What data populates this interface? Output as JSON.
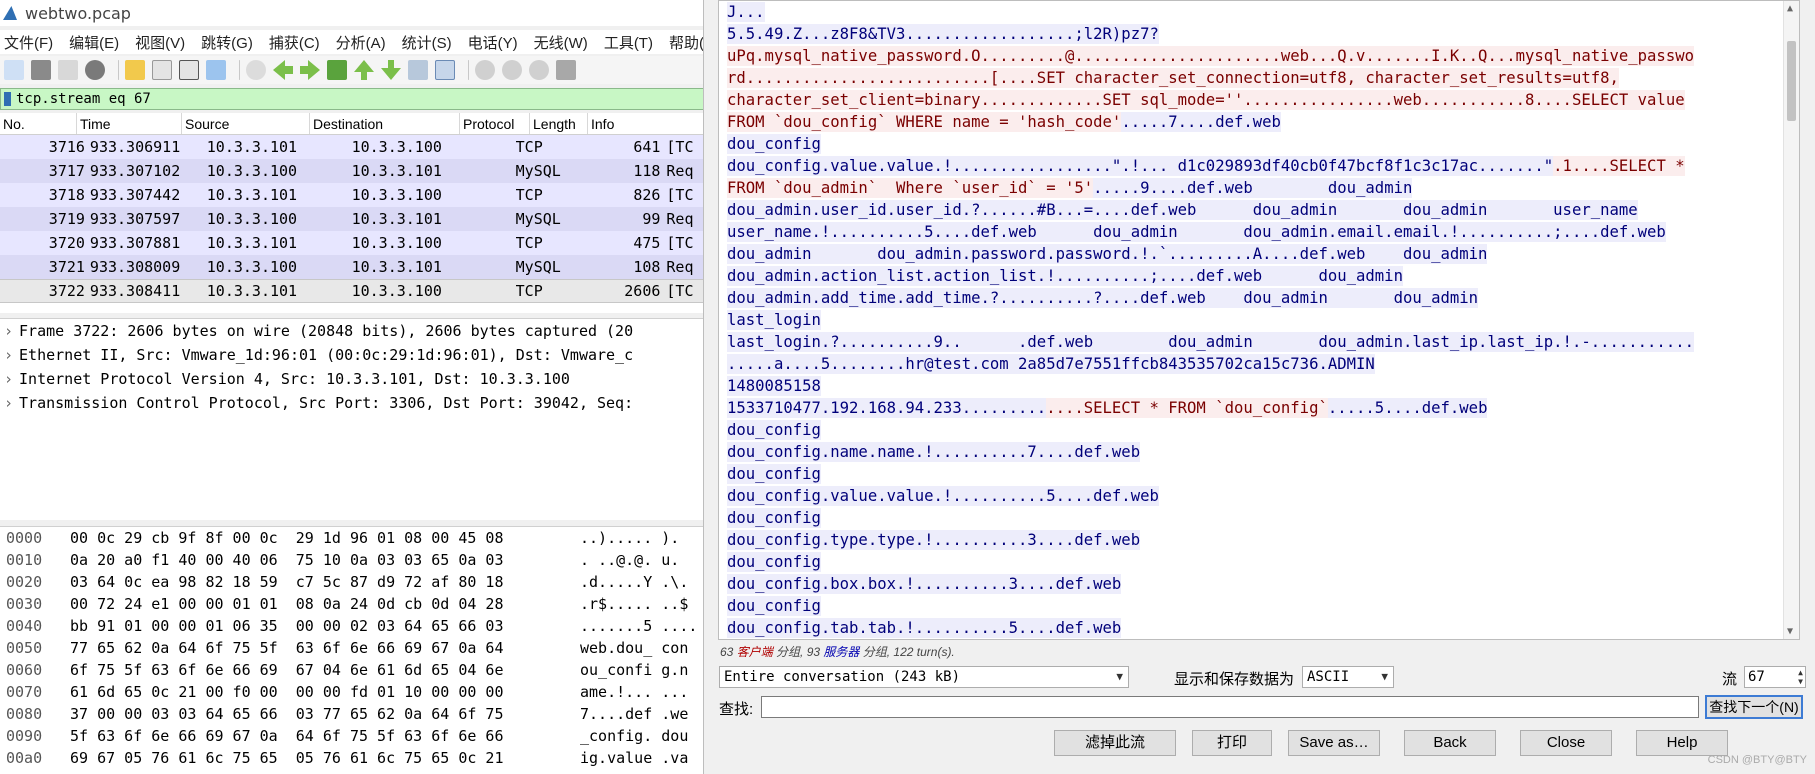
{
  "title": "webtwo.pcap",
  "menu": [
    "文件(F)",
    "编辑(E)",
    "视图(V)",
    "跳转(G)",
    "捕获(C)",
    "分析(A)",
    "统计(S)",
    "电话(Y)",
    "无线(W)",
    "工具(T)",
    "帮助("
  ],
  "display_filter": "tcp.stream eq 67",
  "packet_list": {
    "headers": [
      "No.",
      "Time",
      "Source",
      "Destination",
      "Protocol",
      "Length",
      "Info"
    ],
    "rows": [
      {
        "no": "3716",
        "time": "933.306911",
        "src": "10.3.3.101",
        "dst": "10.3.3.100",
        "proto": "TCP",
        "len": "641",
        "info": "[TC"
      },
      {
        "no": "3717",
        "time": "933.307102",
        "src": "10.3.3.100",
        "dst": "10.3.3.101",
        "proto": "MySQL",
        "len": "118",
        "info": "Req"
      },
      {
        "no": "3718",
        "time": "933.307442",
        "src": "10.3.3.101",
        "dst": "10.3.3.100",
        "proto": "TCP",
        "len": "826",
        "info": "[TC"
      },
      {
        "no": "3719",
        "time": "933.307597",
        "src": "10.3.3.100",
        "dst": "10.3.3.101",
        "proto": "MySQL",
        "len": "99",
        "info": "Req"
      },
      {
        "no": "3720",
        "time": "933.307881",
        "src": "10.3.3.101",
        "dst": "10.3.3.100",
        "proto": "TCP",
        "len": "475",
        "info": "[TC"
      },
      {
        "no": "3721",
        "time": "933.308009",
        "src": "10.3.3.100",
        "dst": "10.3.3.101",
        "proto": "MySQL",
        "len": "108",
        "info": "Req"
      },
      {
        "no": "3722",
        "time": "933.308411",
        "src": "10.3.3.101",
        "dst": "10.3.3.100",
        "proto": "TCP",
        "len": "2606",
        "info": "[TC"
      }
    ]
  },
  "details": [
    "Frame 3722: 2606 bytes on wire (20848 bits), 2606 bytes captured (20",
    "Ethernet II, Src: Vmware_1d:96:01 (00:0c:29:1d:96:01), Dst: Vmware_c",
    "Internet Protocol Version 4, Src: 10.3.3.101, Dst: 10.3.3.100",
    "Transmission Control Protocol, Src Port: 3306, Dst Port: 39042, Seq:"
  ],
  "hex": [
    {
      "off": "0000",
      "bytes": "00 0c 29 cb 9f 8f 00 0c  29 1d 96 01 08 00 45 08",
      "ascii": "..)..... )."
    },
    {
      "off": "0010",
      "bytes": "0a 20 a0 f1 40 00 40 06  75 10 0a 03 03 65 0a 03",
      "ascii": ". ..@.@. u."
    },
    {
      "off": "0020",
      "bytes": "03 64 0c ea 98 82 18 59  c7 5c 87 d9 72 af 80 18",
      "ascii": ".d.....Y .\\."
    },
    {
      "off": "0030",
      "bytes": "00 72 24 e1 00 00 01 01  08 0a 24 0d cb 0d 04 28",
      "ascii": ".r$..... ..$"
    },
    {
      "off": "0040",
      "bytes": "bb 91 01 00 00 01 06 35  00 00 02 03 64 65 66 03",
      "ascii": ".......5 ...."
    },
    {
      "off": "0050",
      "bytes": "77 65 62 0a 64 6f 75 5f  63 6f 6e 66 69 67 0a 64",
      "ascii": "web.dou_ con"
    },
    {
      "off": "0060",
      "bytes": "6f 75 5f 63 6f 6e 66 69  67 04 6e 61 6d 65 04 6e",
      "ascii": "ou_confi g.n"
    },
    {
      "off": "0070",
      "bytes": "61 6d 65 0c 21 00 f0 00  00 00 fd 01 10 00 00 00",
      "ascii": "ame.!... ..."
    },
    {
      "off": "0080",
      "bytes": "37 00 00 03 03 64 65 66  03 77 65 62 0a 64 6f 75",
      "ascii": "7....def .we"
    },
    {
      "off": "0090",
      "bytes": "5f 63 6f 6e 66 69 67 0a  64 6f 75 5f 63 6f 6e 66",
      "ascii": "_config. dou"
    },
    {
      "off": "00a0",
      "bytes": "69 67 05 76 61 6c 75 65  05 76 61 6c 75 65 0c 21",
      "ascii": "ig.value .va"
    }
  ],
  "stream": [
    [
      {
        "t": "J...",
        "k": "srv"
      }
    ],
    [
      {
        "t": "5.5.49.Z...z8F8&TV3..................;l2R)pz7?",
        "k": "srv"
      }
    ],
    [
      {
        "t": "uPq.mysql_native_password.O.........@......................web...Q.v.......I.K..Q...mysql_native_passwo",
        "k": "cli"
      }
    ],
    [
      {
        "t": "rd..........................[....SET character_set_connection=utf8, character_set_results=utf8,",
        "k": "cli"
      }
    ],
    [
      {
        "t": "character_set_client=binary.............SET sql_mode=''................web...........8....SELECT value",
        "k": "cli"
      }
    ],
    [
      {
        "t": "FROM `dou_config` WHERE name = 'hash_code'",
        "k": "cli"
      },
      {
        "t": ".....7....def.web",
        "k": "srv"
      }
    ],
    [
      {
        "t": "dou_config",
        "k": "srv"
      }
    ],
    [
      {
        "t": "dou_config.value.value.!.................\".!... d1c029893df40cb0f47bcf8f1c3c17ac.......\"",
        "k": "srv"
      },
      {
        "t": ".1....SELECT *",
        "k": "cli"
      }
    ],
    [
      {
        "t": "FROM `dou_admin`  Where `user_id` = '5'",
        "k": "cli"
      },
      {
        "t": ".....9....def.web        dou_admin",
        "k": "srv"
      }
    ],
    [
      {
        "t": "dou_admin.user_id.user_id.?......#B...=....def.web      dou_admin       dou_admin       user_name",
        "k": "srv"
      }
    ],
    [
      {
        "t": "user_name.!..........5....def.web      dou_admin       dou_admin.email.email.!..........;....def.web",
        "k": "srv"
      }
    ],
    [
      {
        "t": "dou_admin       dou_admin.password.password.!.`.........A....def.web    dou_admin",
        "k": "srv"
      }
    ],
    [
      {
        "t": "dou_admin.action_list.action_list.!..........;....def.web      dou_admin",
        "k": "srv"
      }
    ],
    [
      {
        "t": "dou_admin.add_time.add_time.?..........?....def.web    dou_admin       dou_admin",
        "k": "srv"
      }
    ],
    [
      {
        "t": "last_login",
        "k": "srv"
      }
    ],
    [
      {
        "t": "last_login.?..........9..      .def.web        dou_admin       dou_admin.last_ip.last_ip.!.-...........",
        "k": "srv"
      }
    ],
    [
      {
        "t": ".....a....5........hr@test.com 2a85d7e7551ffcb843535702ca15c736.ADMIN",
        "k": "srv"
      }
    ],
    [
      {
        "t": "1480085158",
        "k": "srv"
      }
    ],
    [
      {
        "t": "1533710477.192.168.94.233.........",
        "k": "srv"
      },
      {
        "t": "....SELECT * FROM `dou_config`",
        "k": "cli"
      },
      {
        "t": ".....5....def.web",
        "k": "srv"
      }
    ],
    [
      {
        "t": "dou_config",
        "k": "srv"
      }
    ],
    [
      {
        "t": "dou_config.name.name.!..........7....def.web",
        "k": "srv"
      }
    ],
    [
      {
        "t": "dou_config",
        "k": "srv"
      }
    ],
    [
      {
        "t": "dou_config.value.value.!..........5....def.web",
        "k": "srv"
      }
    ],
    [
      {
        "t": "dou_config",
        "k": "srv"
      }
    ],
    [
      {
        "t": "dou_config.type.type.!..........3....def.web",
        "k": "srv"
      }
    ],
    [
      {
        "t": "dou_config",
        "k": "srv"
      }
    ],
    [
      {
        "t": "dou_config.box.box.!..........3....def.web",
        "k": "srv"
      }
    ],
    [
      {
        "t": "dou_config",
        "k": "srv"
      }
    ],
    [
      {
        "t": "dou_config.tab.tab.!..........5....def.web",
        "k": "srv"
      }
    ]
  ],
  "summary": {
    "a": "63 ",
    "client": "客户端",
    "b": " 分组, 93 ",
    "server": "服务器",
    "c": " 分组, 122 turn(s)."
  },
  "conversation": "Entire conversation (243 kB)",
  "show_save_label": "显示和保存数据为",
  "encoding": "ASCII",
  "stream_label": "流",
  "stream_number": "67",
  "find_label": "查找:",
  "find_value": "",
  "find_next": "查找下一个(N)",
  "buttons": {
    "filter_out": "滤掉此流",
    "print": "打印",
    "save_as": "Save as…",
    "back": "Back",
    "close": "Close",
    "help": "Help"
  },
  "watermark": "CSDN @BTY@BTY",
  "colors": {
    "client_bg": "#fbeded",
    "client_fg": "#7a0000",
    "server_bg": "#ededfb",
    "server_fg": "#00007a",
    "filter_ok": "#c8f7c5"
  }
}
